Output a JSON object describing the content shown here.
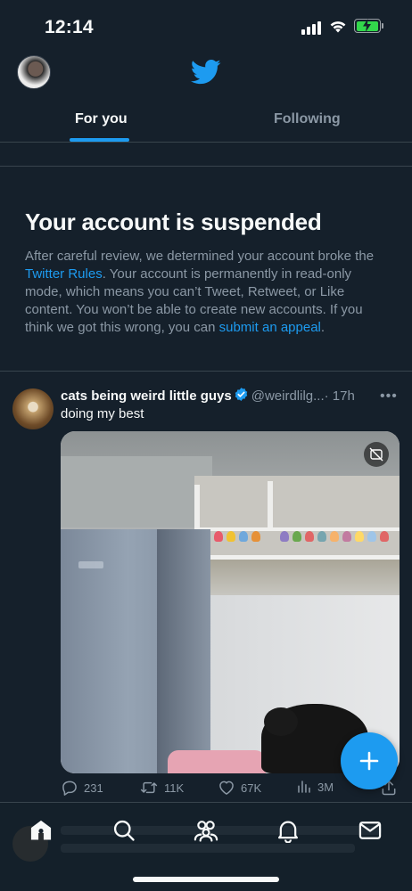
{
  "status_bar": {
    "time": "12:14"
  },
  "header": {
    "logo": "twitter-bird-icon"
  },
  "tabs": [
    {
      "label": "For you",
      "active": true
    },
    {
      "label": "Following",
      "active": false
    }
  ],
  "suspension": {
    "title": "Your account is suspended",
    "body_1": "After careful review, we determined your account broke the ",
    "rules_link": "Twitter Rules",
    "body_2": ". Your account is permanently in read-only mode, which means you can’t Tweet, Retweet, or Like content. You won’t be able to create new accounts. If you think we got this wrong, you can ",
    "appeal_link": "submit an appeal",
    "body_3": "."
  },
  "tweet": {
    "display_name": "cats being weird little guys",
    "handle": "@weirdlilg...",
    "time": "· 17h",
    "text": "doing my best",
    "stats": {
      "replies": "231",
      "retweets": "11K",
      "likes": "67K",
      "views": "3M"
    }
  },
  "colors": {
    "background": "#15202b",
    "accent": "#1d9bf0",
    "text_primary": "#f7f9f9",
    "text_secondary": "#8b98a5",
    "divider": "#38444d"
  }
}
